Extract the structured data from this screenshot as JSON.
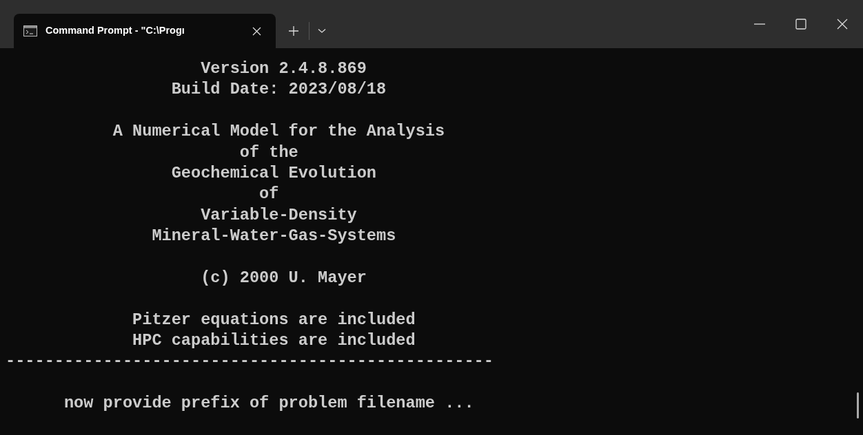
{
  "tabs": [
    {
      "title": "Command Prompt - \"C:\\Progı",
      "selected": true
    }
  ],
  "terminal": {
    "blocks": [
      [
        "                    Version 2.4.8.869",
        "                 Build Date: 2023/08/18"
      ],
      [
        "           A Numerical Model for the Analysis",
        "                        of the",
        "                 Geochemical Evolution",
        "                          of",
        "                    Variable-Density",
        "               Mineral-Water-Gas-Systems"
      ],
      [
        "                    (c) 2000 U. Mayer"
      ],
      [
        "             Pitzer equations are included",
        "             HPC capabilities are included",
        "--------------------------------------------------"
      ],
      [
        "      now provide prefix of problem filename ..."
      ]
    ]
  }
}
